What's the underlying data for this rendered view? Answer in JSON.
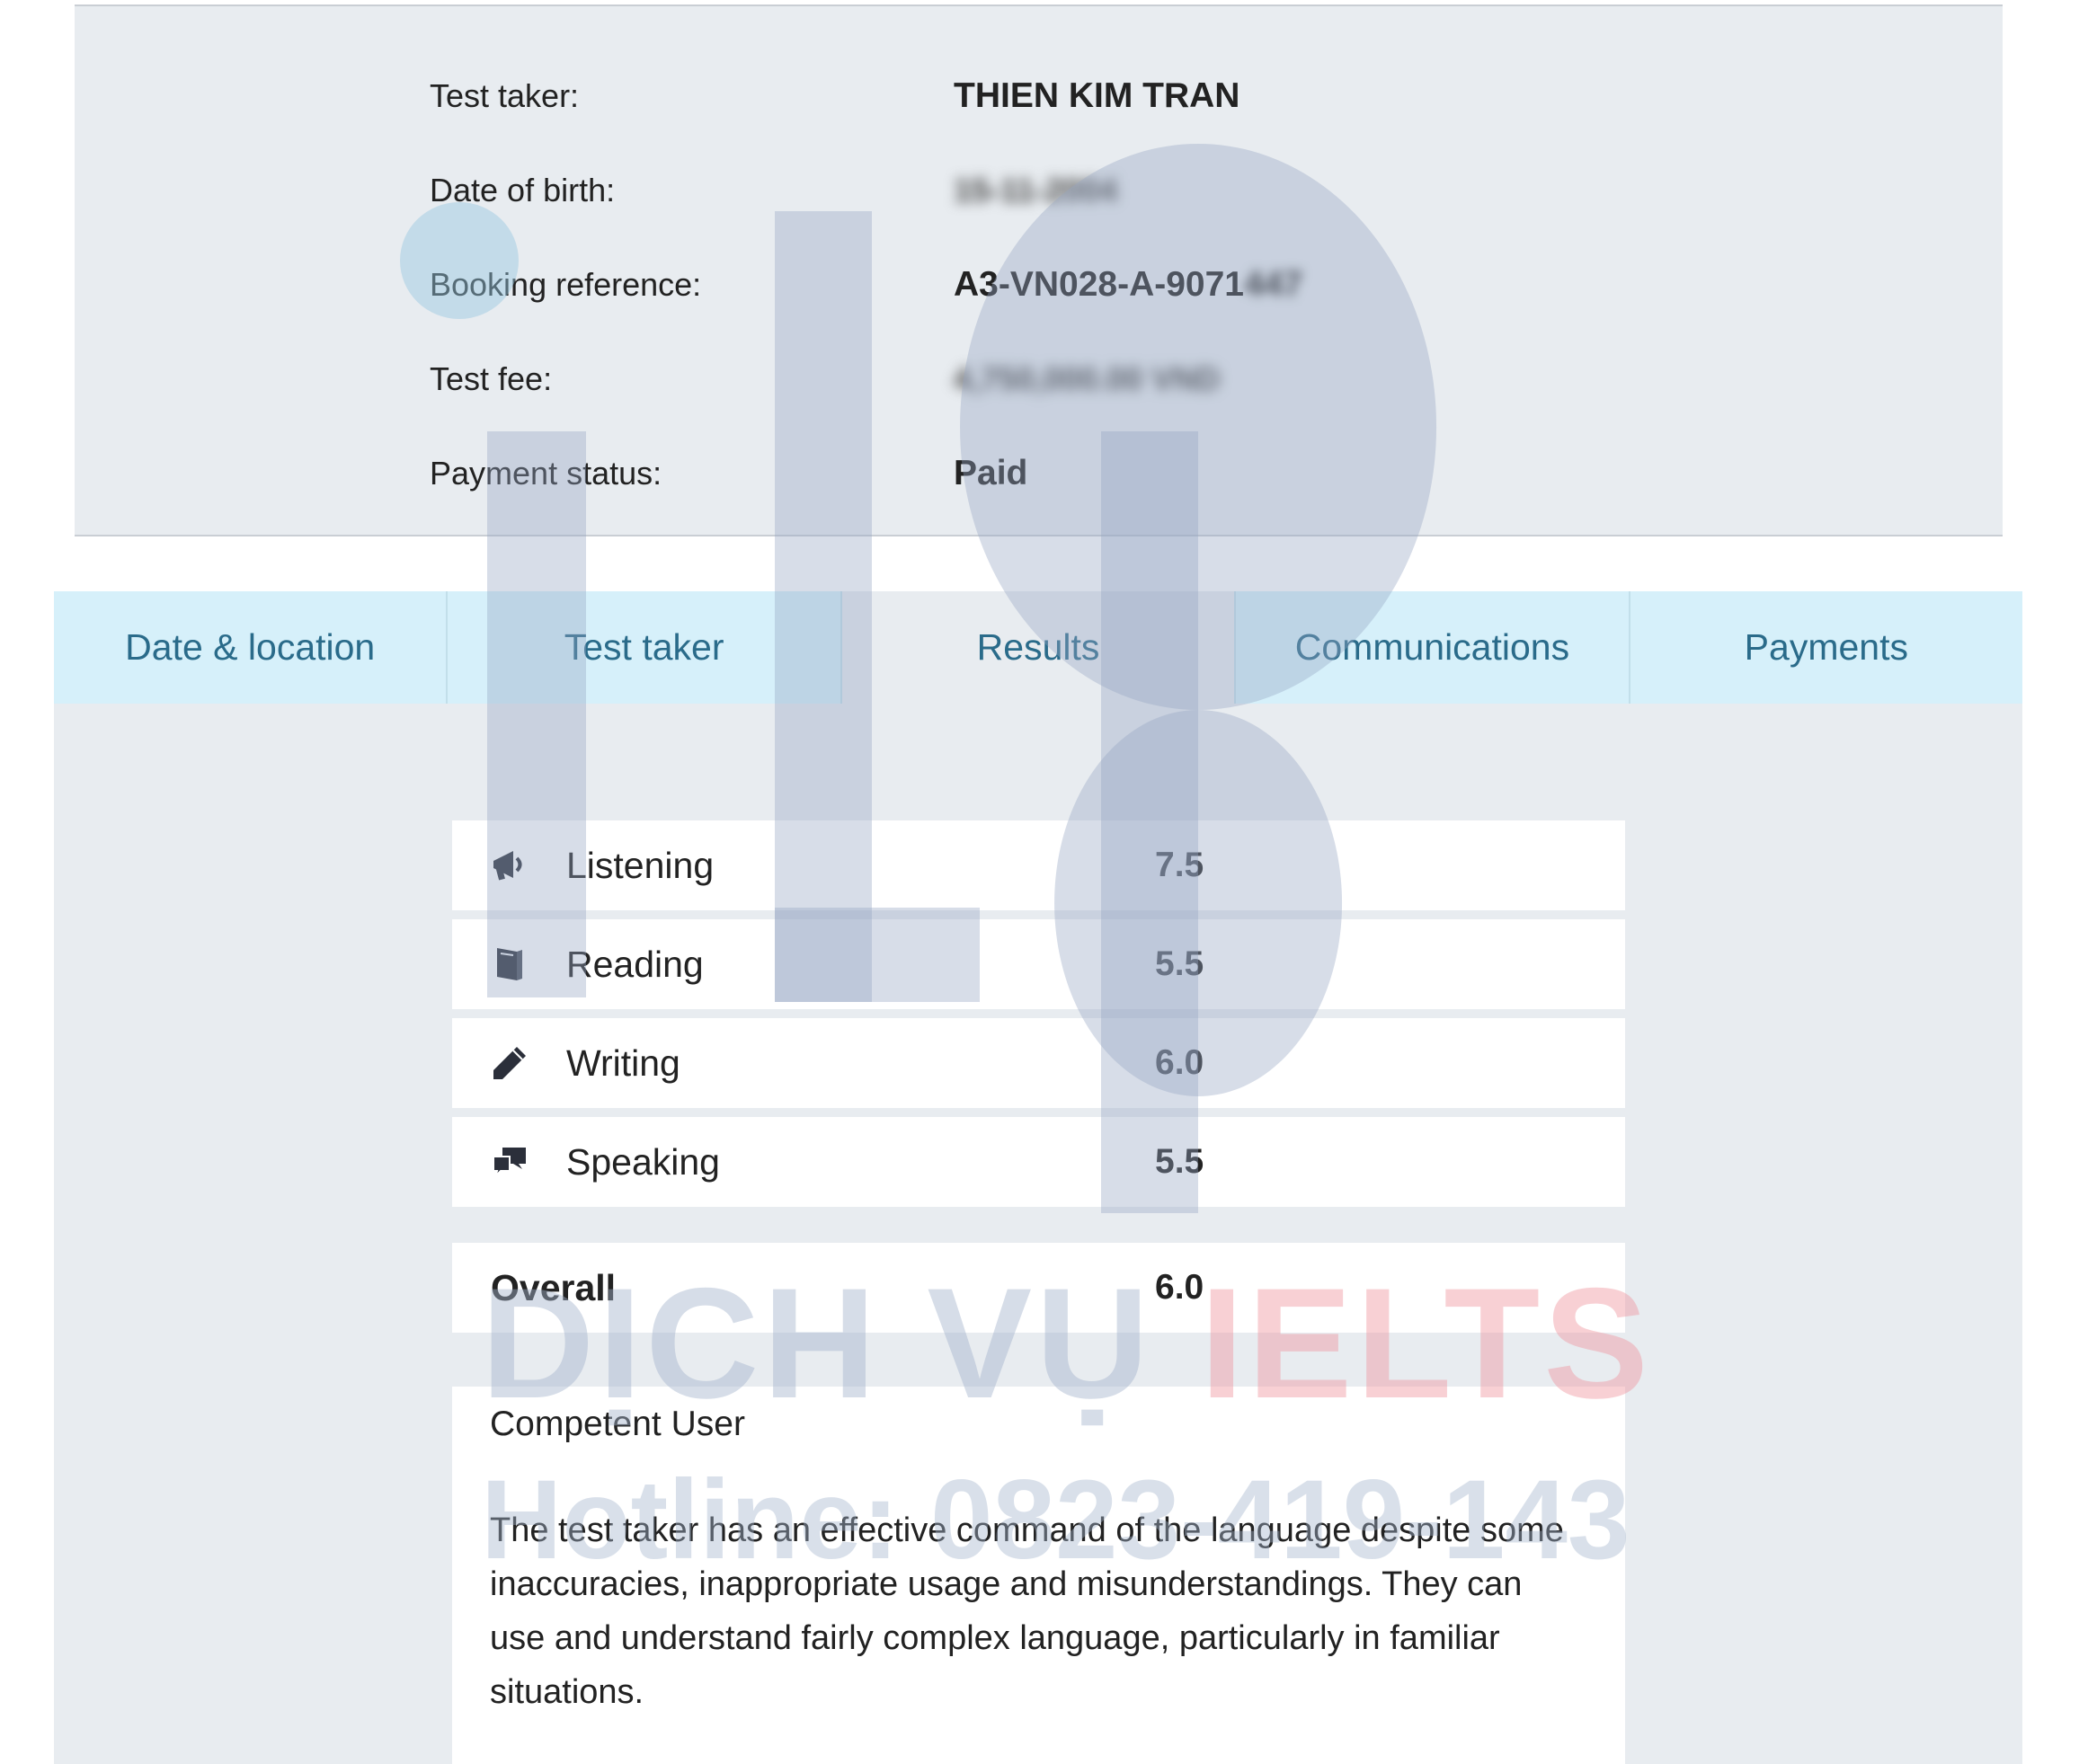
{
  "header": {
    "rows": [
      {
        "label": "Test taker:",
        "value": "THIEN KIM TRAN"
      },
      {
        "label": "Date of birth:",
        "value": "15-11-2004"
      },
      {
        "label": "Booking reference:",
        "value": "A3-VN028-A-9071",
        "value_tail": "447"
      },
      {
        "label": "Test fee:",
        "value": "4,750,000.00 VND"
      },
      {
        "label": "Payment status:",
        "value": "Paid"
      }
    ]
  },
  "tabs": [
    {
      "label": "Date & location",
      "active": false
    },
    {
      "label": "Test taker",
      "active": false
    },
    {
      "label": "Results",
      "active": true
    },
    {
      "label": "Communications",
      "active": false
    },
    {
      "label": "Payments",
      "active": false
    }
  ],
  "results": {
    "scores": [
      {
        "name": "Listening",
        "score": "7.5",
        "icon": "megaphone-icon"
      },
      {
        "name": "Reading",
        "score": "5.5",
        "icon": "book-icon"
      },
      {
        "name": "Writing",
        "score": "6.0",
        "icon": "pencil-icon"
      },
      {
        "name": "Speaking",
        "score": "5.5",
        "icon": "speech-bubbles-icon"
      }
    ],
    "overall": {
      "name": "Overall",
      "score": "6.0"
    },
    "level": "Competent User",
    "description": "The test taker has an effective command of the language despite some inaccuracies, inappropriate usage and misunderstandings. They can use and understand fairly complex language, particularly in familiar situations."
  },
  "watermark": {
    "logo_text": "Lp",
    "line1_a": "DỊCH VỤ ",
    "line1_b": "IELTS",
    "line2": "Hotline: 0823-419-143"
  },
  "colors": {
    "tab_bg": "#d6f0fa",
    "tab_text": "#2a6b8a",
    "panel_bg": "#e8ecf0"
  }
}
